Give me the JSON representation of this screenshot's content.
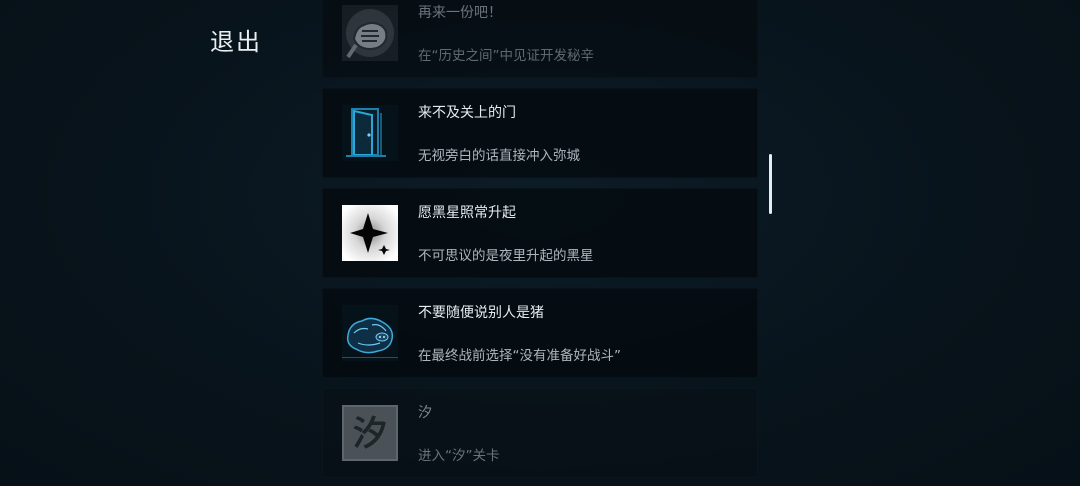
{
  "header": {
    "exit_label": "退出"
  },
  "achievements": [
    {
      "title": "再来一份吧！",
      "desc": "在“历史之间”中见证开发秘辛",
      "icon": "fist-icon",
      "state": "partial"
    },
    {
      "title": "来不及关上的门",
      "desc": "无视旁白的话直接冲入弥城",
      "icon": "door-icon",
      "state": "unlocked"
    },
    {
      "title": "愿黑星照常升起",
      "desc": "不可思议的是夜里升起的黑星",
      "icon": "black-star-icon",
      "state": "unlocked"
    },
    {
      "title": "不要随便说别人是猪",
      "desc": "在最终战前选择“没有准备好战斗”",
      "icon": "pig-icon",
      "state": "unlocked"
    },
    {
      "title": "汐",
      "desc": "进入“汐”关卡",
      "icon": "xi-character-icon",
      "icon_text": "汐",
      "state": "locked"
    }
  ],
  "colors": {
    "background": "#08131b",
    "accent": "#2aa6d8"
  }
}
